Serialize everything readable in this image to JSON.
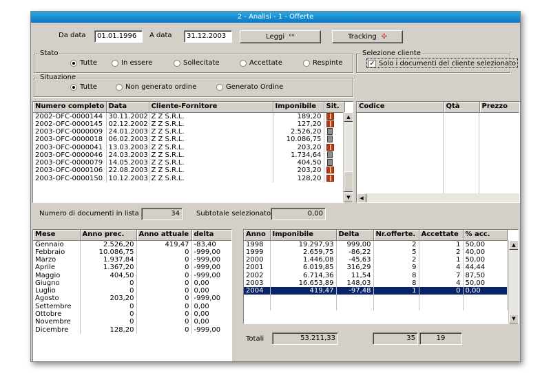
{
  "window": {
    "title": "2 - Analisi - 1 - Offerte"
  },
  "filters": {
    "from_label": "Da data",
    "from_value": "01.01.1996",
    "to_label": "A data",
    "to_value": "31.12.2003",
    "read_button": "Leggi",
    "tracking_button": "Tracking"
  },
  "stato": {
    "title": "Stato",
    "options": [
      "Tutte",
      "In essere",
      "Sollecitate",
      "Accettate",
      "Respinte"
    ],
    "selected": "Tutte"
  },
  "client_selection": {
    "title": "Selezione cliente",
    "checkbox_label": "Solo i documenti del cliente selezionato",
    "checked": true
  },
  "situazione": {
    "title": "Situazione",
    "options": [
      "Tutte",
      "Non generato ordine",
      "Generato Ordine"
    ],
    "selected": "Tutte"
  },
  "documents": {
    "columns": [
      "Numero completo",
      "Data",
      "Cliente-Fornitore",
      "Imponibile",
      "Sit."
    ],
    "rows": [
      {
        "numero": "2002-OFC-0000144",
        "data": "30.11.2002",
        "cliente": "Z Z S.R.L.",
        "imponibile": "189,20",
        "sit": "gift-icon"
      },
      {
        "numero": "2002-OFC-0000145",
        "data": "02.12.2002",
        "cliente": "Z Z S.R.L.",
        "imponibile": "127,20",
        "sit": "gift-icon"
      },
      {
        "numero": "2003-OFC-0000009",
        "data": "24.01.2003",
        "cliente": "Z Z S.R.L.",
        "imponibile": "2.526,20",
        "sit": "trash-icon"
      },
      {
        "numero": "2003-OFC-0000018",
        "data": "06.02.2003",
        "cliente": "Z Z S.R.L.",
        "imponibile": "10.086,75",
        "sit": "trash-icon"
      },
      {
        "numero": "2003-OFC-0000041",
        "data": "13.03.2003",
        "cliente": "Z Z S.R.L.",
        "imponibile": "203,20",
        "sit": "gift-icon"
      },
      {
        "numero": "2003-OFC-0000046",
        "data": "24.03.2003",
        "cliente": "Z Z S.R.L.",
        "imponibile": "1.734,64",
        "sit": "trash-icon"
      },
      {
        "numero": "2003-OFC-0000079",
        "data": "14.05.2003",
        "cliente": "Z Z S.R.L.",
        "imponibile": "404,50",
        "sit": "trash-icon"
      },
      {
        "numero": "2003-OFC-0000106",
        "data": "22.08.2003",
        "cliente": "Z Z S.R.L.",
        "imponibile": "203,20",
        "sit": "gift-icon"
      },
      {
        "numero": "2003-OFC-0000150",
        "data": "10.12.2003",
        "cliente": "Z Z S.R.L.",
        "imponibile": "128,20",
        "sit": "gift-icon"
      }
    ]
  },
  "details": {
    "columns": [
      "Codice",
      "Qtà",
      "Prezzo"
    ]
  },
  "summary": {
    "count_label": "Numero di documenti in lista",
    "count_value": "34",
    "subtotal_label": "Subtotale selezionato",
    "subtotal_value": "0,00"
  },
  "monthly": {
    "columns": [
      "Mese",
      "Anno prec.",
      "Anno attuale",
      "delta"
    ],
    "rows": [
      {
        "mese": "Gennaio",
        "prec": "2.526,20",
        "att": "419,47",
        "delta": "-83,40"
      },
      {
        "mese": "Febbraio",
        "prec": "10.086,75",
        "att": "0",
        "delta": "-999,00"
      },
      {
        "mese": "Marzo",
        "prec": "1.937,84",
        "att": "0",
        "delta": "-999,00"
      },
      {
        "mese": "Aprile",
        "prec": "1.367,20",
        "att": "0",
        "delta": "-999,00"
      },
      {
        "mese": "Maggio",
        "prec": "404,50",
        "att": "0",
        "delta": "-999,00"
      },
      {
        "mese": "Giugno",
        "prec": "0",
        "att": "0",
        "delta": "0,00"
      },
      {
        "mese": "Luglio",
        "prec": "0",
        "att": "0",
        "delta": "0,00"
      },
      {
        "mese": "Agosto",
        "prec": "203,20",
        "att": "0",
        "delta": "-999,00"
      },
      {
        "mese": "Settembre",
        "prec": "0",
        "att": "0",
        "delta": "0,00"
      },
      {
        "mese": "Ottobre",
        "prec": "0",
        "att": "0",
        "delta": "0,00"
      },
      {
        "mese": "Novembre",
        "prec": "0",
        "att": "0",
        "delta": "0,00"
      },
      {
        "mese": "Dicembre",
        "prec": "128,20",
        "att": "0",
        "delta": "-999,00"
      }
    ]
  },
  "yearly": {
    "columns": [
      "Anno",
      "Imponibile",
      "Delta",
      "Nr.offerte.",
      "Accettate",
      "% acc."
    ],
    "rows": [
      {
        "anno": "1998",
        "imp": "19.297,93",
        "delta": "999,00",
        "nr": "2",
        "acc": "1",
        "pct": "50,00"
      },
      {
        "anno": "1999",
        "imp": "2.659,75",
        "delta": "-86,22",
        "nr": "5",
        "acc": "2",
        "pct": "40,00"
      },
      {
        "anno": "2000",
        "imp": "1.446,08",
        "delta": "-45,63",
        "nr": "2",
        "acc": "1",
        "pct": "50,00"
      },
      {
        "anno": "2001",
        "imp": "6.019,85",
        "delta": "316,29",
        "nr": "9",
        "acc": "4",
        "pct": "44,44"
      },
      {
        "anno": "2002",
        "imp": "6.714,36",
        "delta": "11,54",
        "nr": "8",
        "acc": "7",
        "pct": "87,50"
      },
      {
        "anno": "2003",
        "imp": "16.653,89",
        "delta": "148,03",
        "nr": "8",
        "acc": "4",
        "pct": "50,00"
      },
      {
        "anno": "2004",
        "imp": "419,47",
        "delta": "-97,48",
        "nr": "1",
        "acc": "0",
        "pct": "0,00"
      }
    ],
    "selected_index": 6
  },
  "totals": {
    "label": "Totali",
    "imponibile": "53.211,33",
    "nr": "35",
    "acc": "19"
  }
}
